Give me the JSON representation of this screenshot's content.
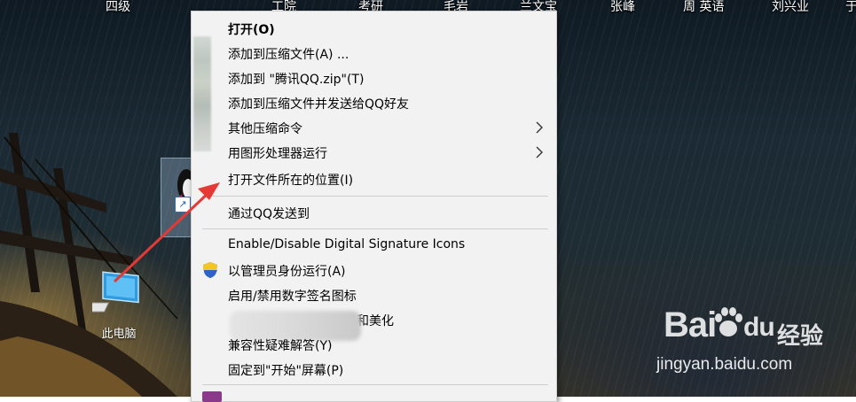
{
  "desktop": {
    "top_labels": [
      "四级",
      "工院",
      "考研",
      "毛岩",
      "兰文宝",
      "张峰",
      "周 英语",
      "刘兴业",
      "于"
    ],
    "this_pc_label": "此电脑"
  },
  "context_menu": {
    "items": [
      {
        "label": "打开(O)",
        "bold": true
      },
      {
        "label": "添加到压缩文件(A) ..."
      },
      {
        "label": "添加到 \"腾讯QQ.zip\"(T)"
      },
      {
        "label": "添加到压缩文件并发送给QQ好友"
      },
      {
        "label": "其他压缩命令",
        "submenu": true
      },
      {
        "label": "用图形处理器运行",
        "submenu": true
      },
      {
        "label": "打开文件所在的位置(I)"
      },
      {
        "label": "通过QQ发送到"
      },
      {
        "label": "Enable/Disable Digital Signature Icons"
      },
      {
        "label": "以管理员身份运行(A)",
        "icon": "uac-shield-icon"
      },
      {
        "label": "启用/禁用数字签名图标"
      },
      {
        "label": "设和美化"
      },
      {
        "label": "兼容性疑难解答(Y)"
      },
      {
        "label": "固定到\"开始\"屏幕(P)"
      }
    ]
  },
  "watermark": {
    "brand": "Bai",
    "brand2": "du",
    "cn": "经验",
    "url": "jingyan.baidu.com"
  },
  "colors": {
    "menu_bg": "#f2f2f2",
    "arrow_red": "#e53935",
    "separator": "#cfcfcf"
  }
}
